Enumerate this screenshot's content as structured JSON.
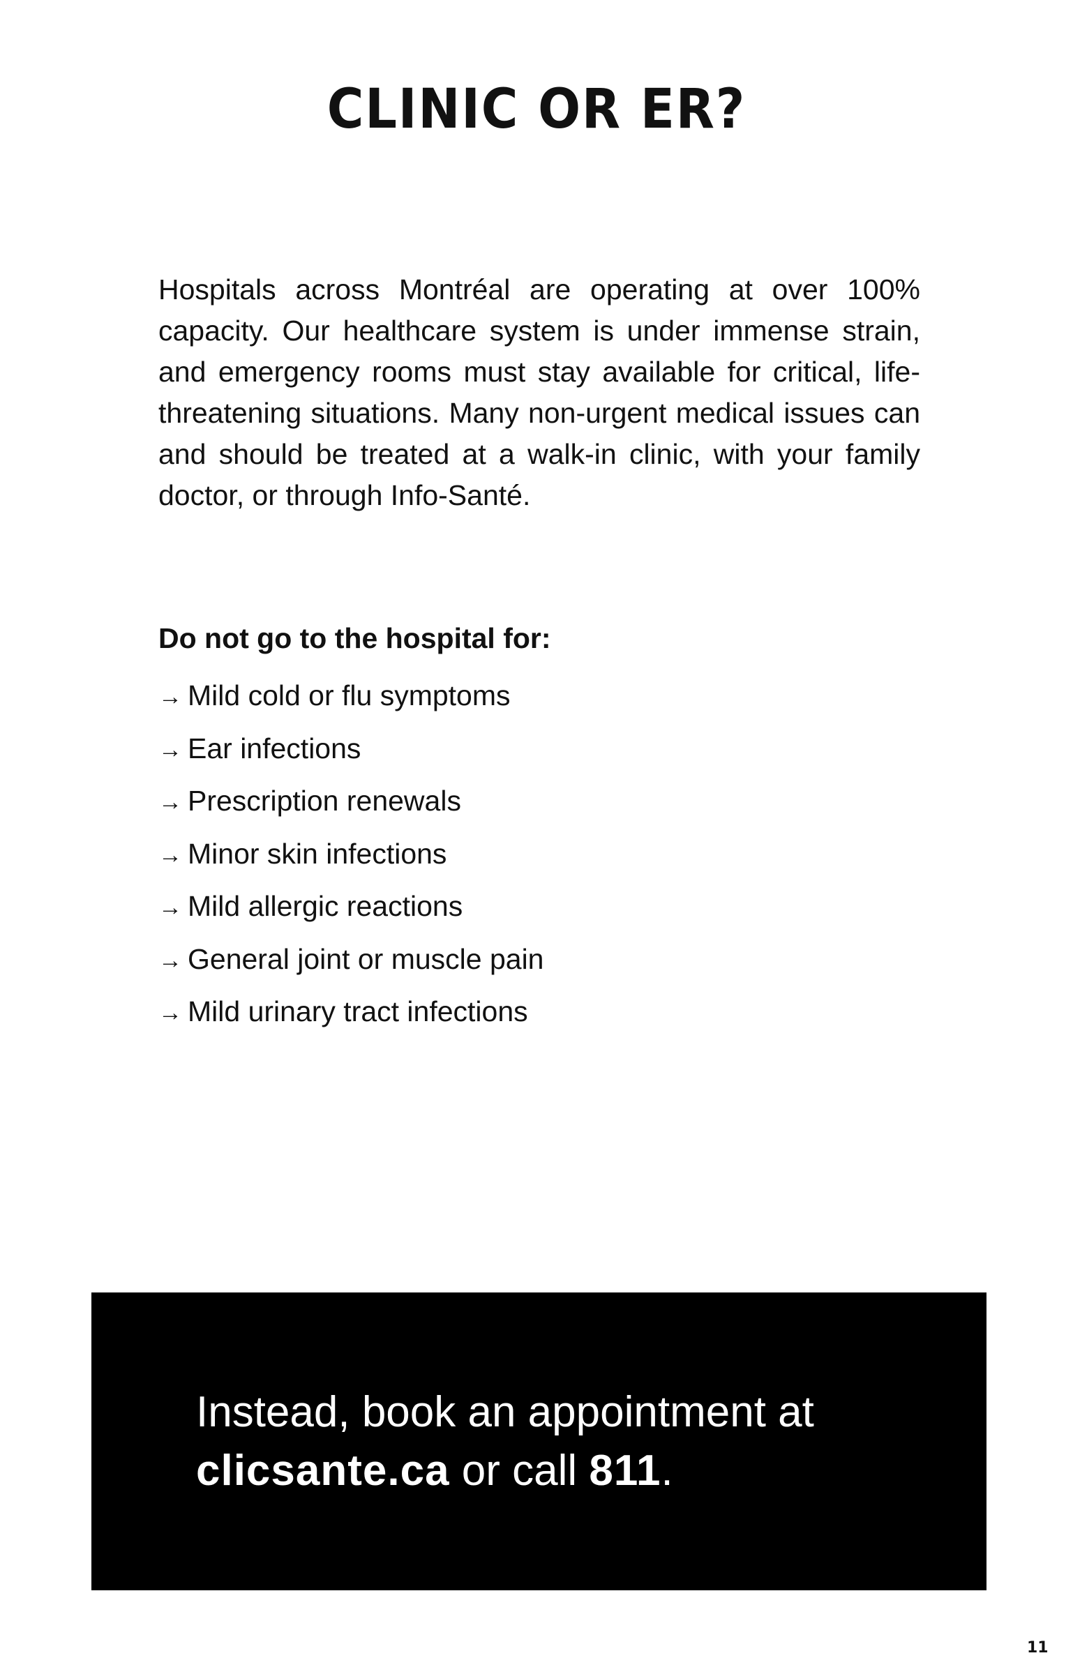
{
  "page": {
    "title": "CLINIC OR ER?",
    "intro": "Hospitals across Montréal are operating at over 100% capacity. Our healthcare system is under immense strain, and emergency rooms must stay available for critical, life-threatening situations. Many non-urgent medical issues can and should be treated at a walk-in clinic, with your family doctor, or through Info-Santé.",
    "list_heading": "Do not go to the hospital for:",
    "arrow_icon": "→",
    "items": [
      "Mild cold or flu symptoms",
      "Ear infections",
      "Prescription renewals",
      "Minor skin infections",
      "Mild allergic reactions",
      "General joint or muscle pain",
      "Mild urinary tract infections"
    ],
    "cta": {
      "line1": "Instead, book an appointment at",
      "website": "clicsante.ca",
      "middle": " or call ",
      "phone": "811",
      "end": "."
    },
    "page_number": "11"
  }
}
